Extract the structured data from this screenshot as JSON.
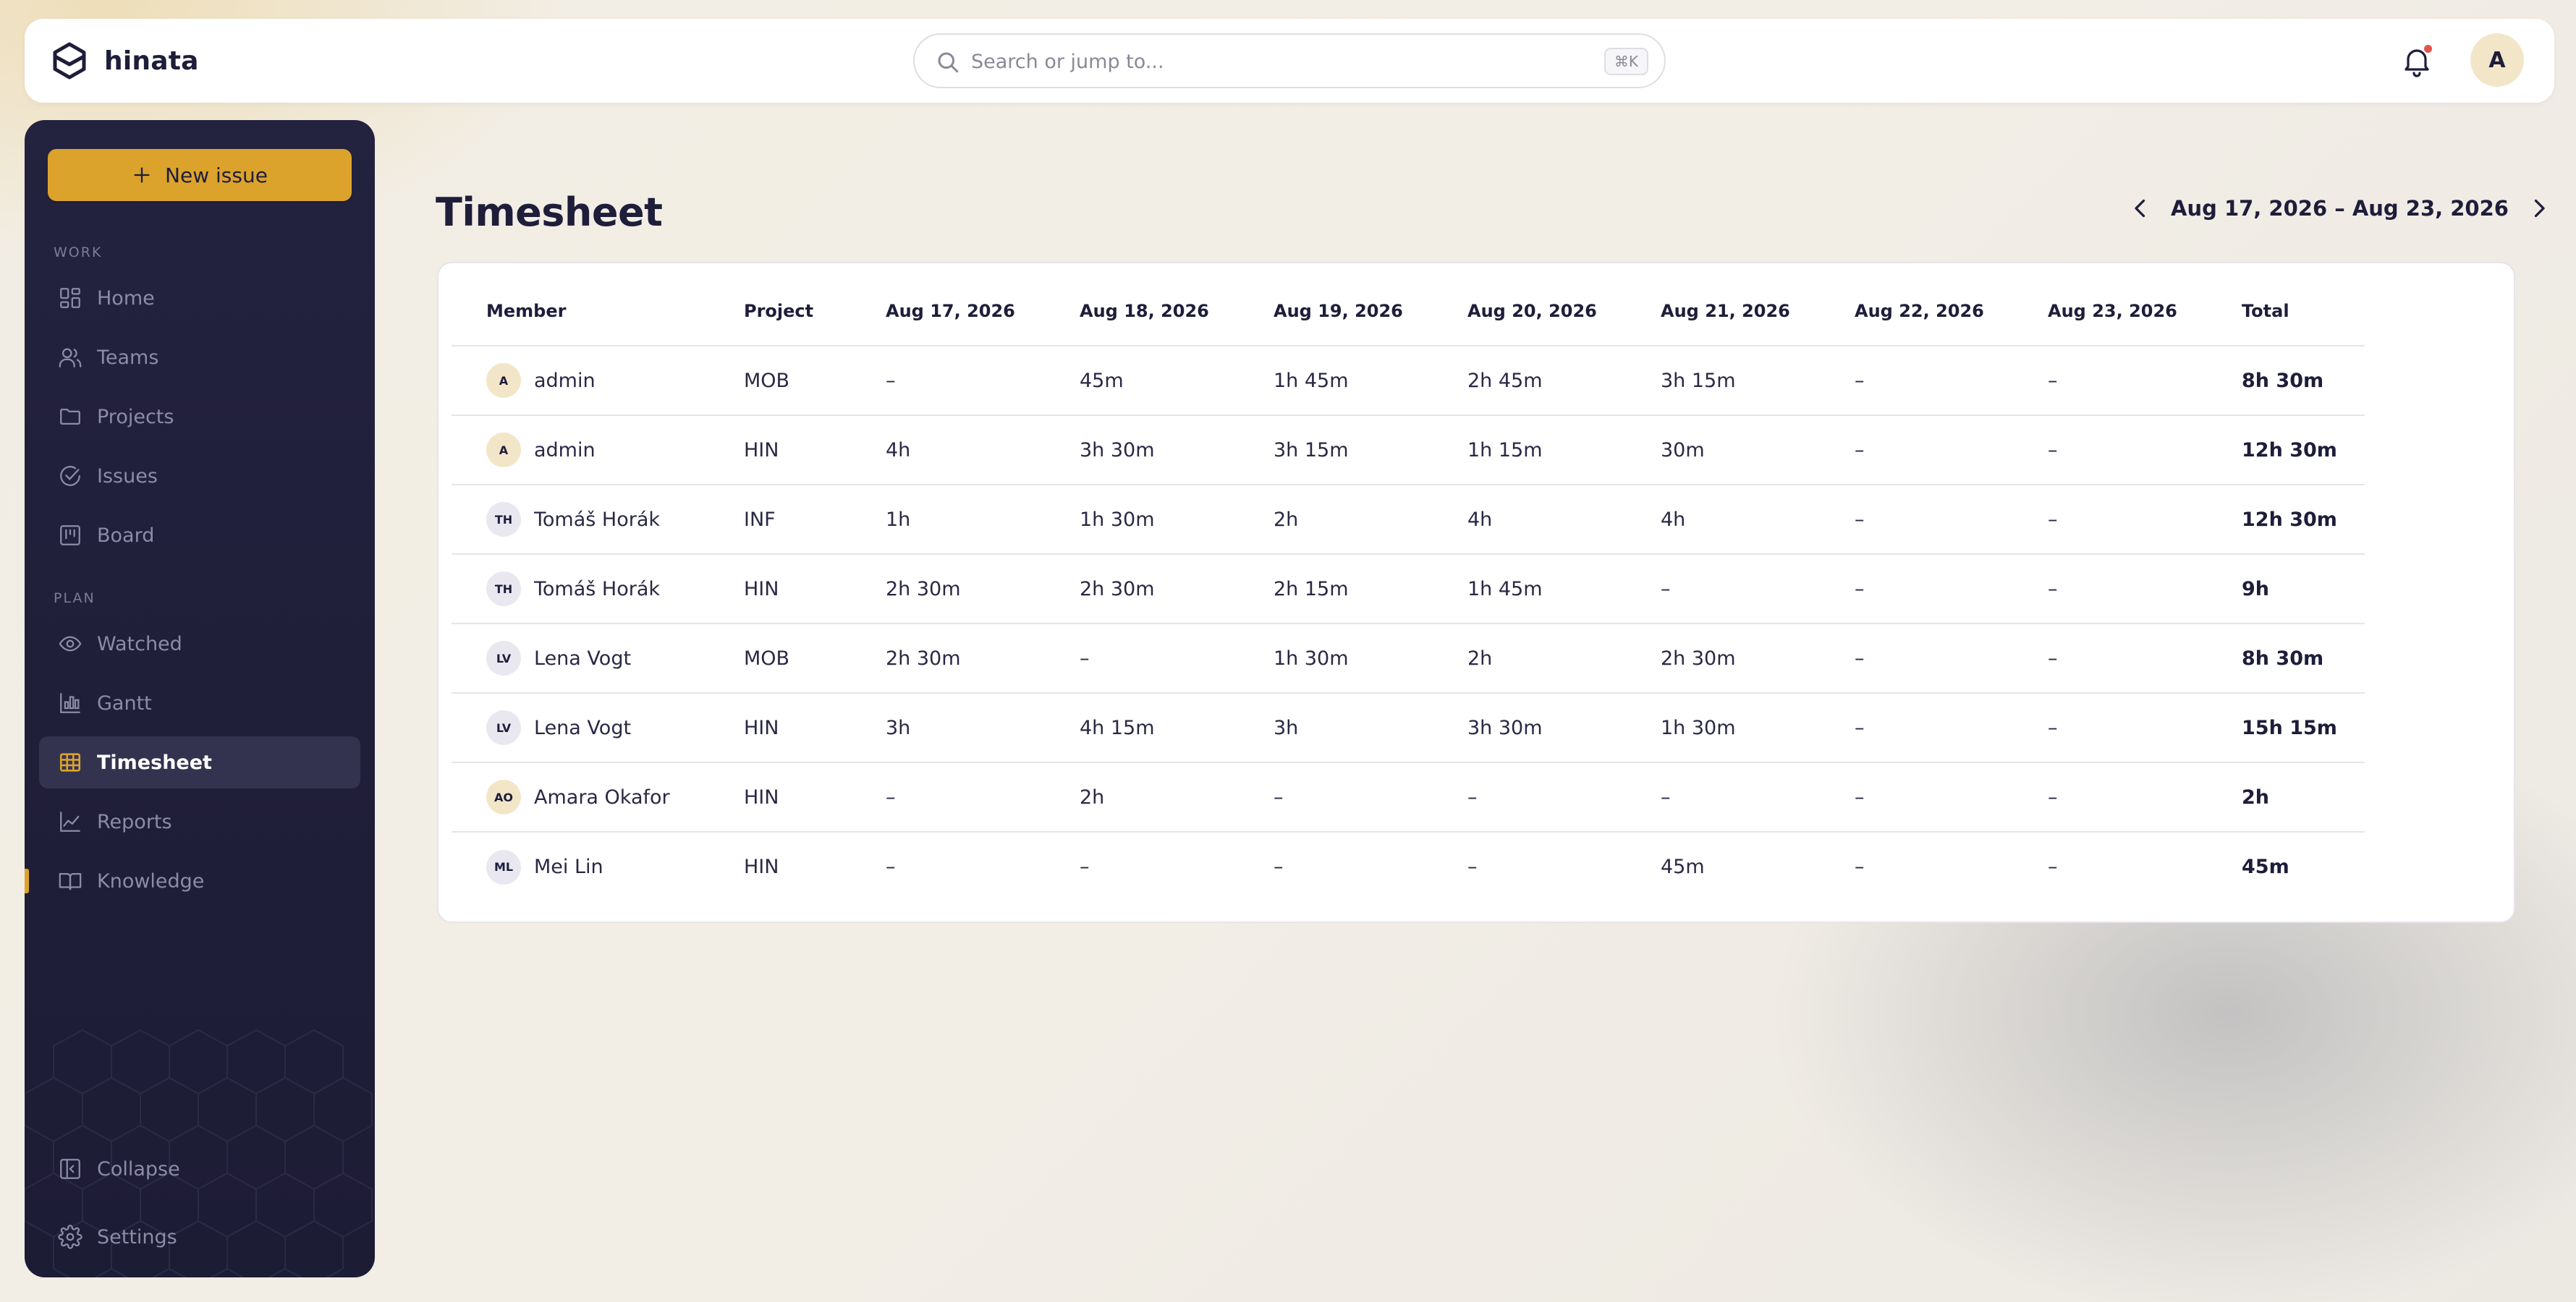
{
  "app": {
    "name": "hinata"
  },
  "search": {
    "placeholder": "Search or jump to...",
    "shortcut": "⌘K"
  },
  "user": {
    "initial": "A"
  },
  "sidebar": {
    "new_issue_label": "New issue",
    "sections": {
      "work": "WORK",
      "plan": "PLAN"
    },
    "items": [
      {
        "label": "Home",
        "icon": "dashboard-icon"
      },
      {
        "label": "Teams",
        "icon": "users-icon"
      },
      {
        "label": "Projects",
        "icon": "folder-icon"
      },
      {
        "label": "Issues",
        "icon": "check-circle-icon"
      },
      {
        "label": "Board",
        "icon": "kanban-icon"
      },
      {
        "label": "Watched",
        "icon": "eye-icon"
      },
      {
        "label": "Gantt",
        "icon": "gantt-icon"
      },
      {
        "label": "Timesheet",
        "icon": "table-icon",
        "active": true
      },
      {
        "label": "Reports",
        "icon": "line-chart-icon"
      },
      {
        "label": "Knowledge",
        "icon": "book-icon"
      }
    ],
    "collapse_label": "Collapse",
    "settings_label": "Settings"
  },
  "page": {
    "title": "Timesheet",
    "range_label": "Aug 17, 2026 – Aug 23, 2026"
  },
  "timesheet": {
    "columns": [
      "Member",
      "Project",
      "Aug 17, 2026",
      "Aug 18, 2026",
      "Aug 19, 2026",
      "Aug 20, 2026",
      "Aug 21, 2026",
      "Aug 22, 2026",
      "Aug 23, 2026",
      "Total"
    ],
    "rows": [
      {
        "initials": "A",
        "member": "admin",
        "project": "MOB",
        "days": [
          "–",
          "45m",
          "1h 45m",
          "2h 45m",
          "3h 15m",
          "–",
          "–"
        ],
        "total": "8h 30m",
        "avatar_color": "#f3e6c8"
      },
      {
        "initials": "A",
        "member": "admin",
        "project": "HIN",
        "days": [
          "4h",
          "3h 30m",
          "3h 15m",
          "1h 15m",
          "30m",
          "–",
          "–"
        ],
        "total": "12h 30m",
        "avatar_color": "#f3e6c8"
      },
      {
        "initials": "TH",
        "member": "Tomáš Horák",
        "project": "INF",
        "days": [
          "1h",
          "1h 30m",
          "2h",
          "4h",
          "4h",
          "–",
          "–"
        ],
        "total": "12h 30m",
        "avatar_color": "#e9e8f1"
      },
      {
        "initials": "TH",
        "member": "Tomáš Horák",
        "project": "HIN",
        "days": [
          "2h 30m",
          "2h 30m",
          "2h 15m",
          "1h 45m",
          "–",
          "–",
          "–"
        ],
        "total": "9h",
        "avatar_color": "#e9e8f1"
      },
      {
        "initials": "LV",
        "member": "Lena Vogt",
        "project": "MOB",
        "days": [
          "2h 30m",
          "–",
          "1h 30m",
          "2h",
          "2h 30m",
          "–",
          "–"
        ],
        "total": "8h 30m",
        "avatar_color": "#e9e8f1"
      },
      {
        "initials": "LV",
        "member": "Lena Vogt",
        "project": "HIN",
        "days": [
          "3h",
          "4h 15m",
          "3h",
          "3h 30m",
          "1h 30m",
          "–",
          "–"
        ],
        "total": "15h 15m",
        "avatar_color": "#e9e8f1"
      },
      {
        "initials": "AO",
        "member": "Amara Okafor",
        "project": "HIN",
        "days": [
          "–",
          "2h",
          "–",
          "–",
          "–",
          "–",
          "–"
        ],
        "total": "2h",
        "avatar_color": "#f3e6c8"
      },
      {
        "initials": "ML",
        "member": "Mei Lin",
        "project": "HIN",
        "days": [
          "–",
          "–",
          "–",
          "–",
          "45m",
          "–",
          "–"
        ],
        "total": "45m",
        "avatar_color": "#e9e8f1"
      }
    ]
  },
  "colors": {
    "accent": "#dca32c",
    "sidebar_bg": "#23223f",
    "text": "#1e1d3a"
  }
}
